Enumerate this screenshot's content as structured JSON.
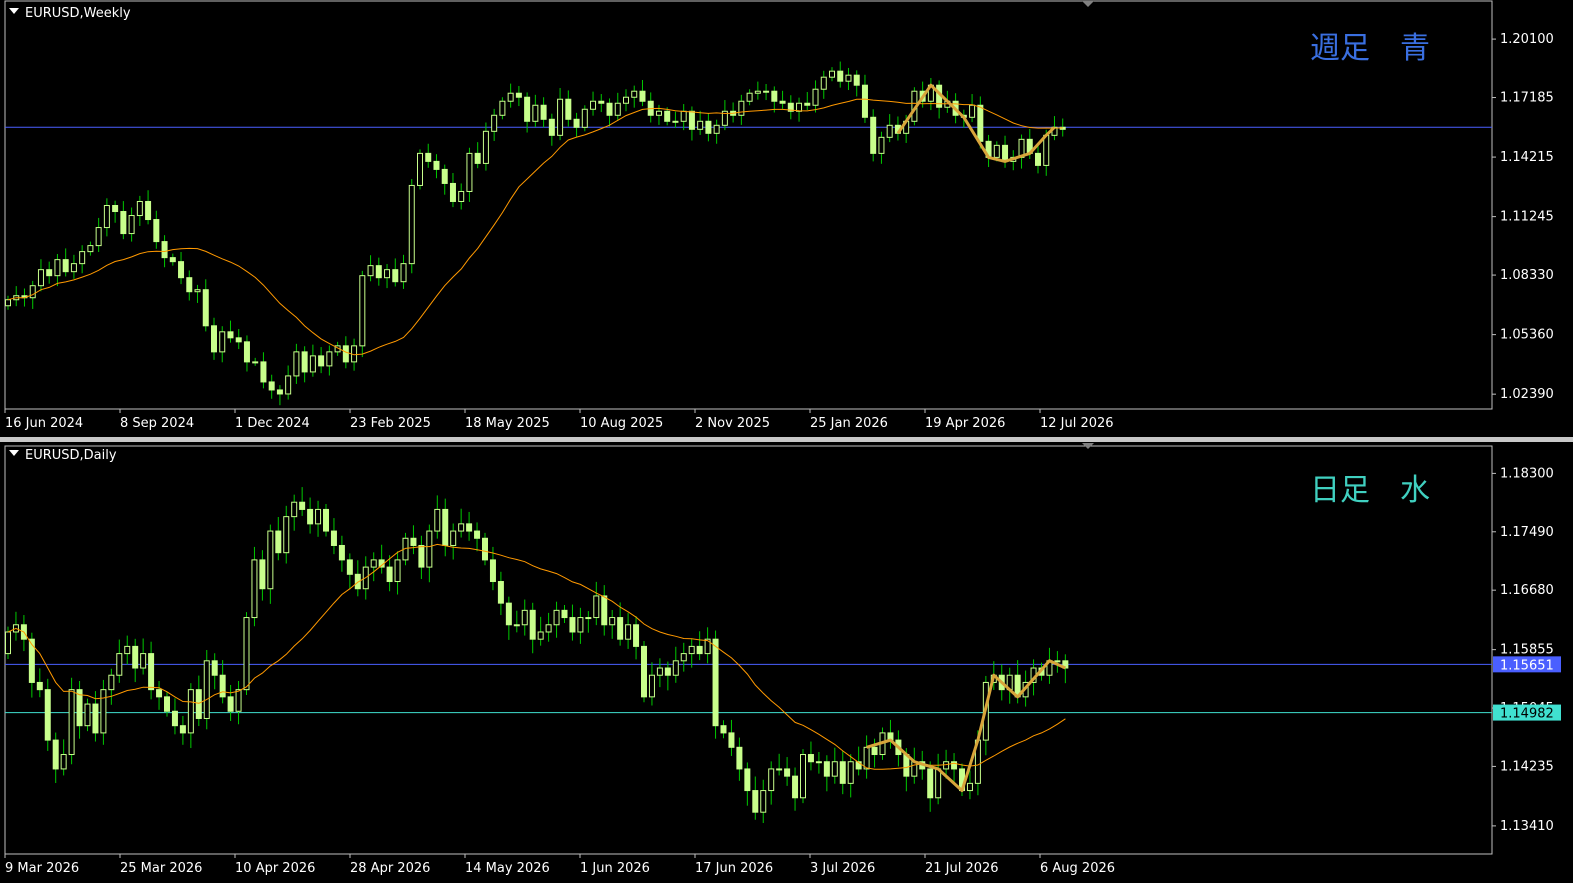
{
  "colors": {
    "background": "#000000",
    "frame": "#c0c0c0",
    "text": "#ffffff",
    "candle": "#c8ff8c",
    "wick": "#00c800",
    "ma": "#ff9900",
    "zigzag": "#d8a53a",
    "weekly_line": "#4a5fff",
    "daily_line_blue": "#4a5fff",
    "daily_line_aqua": "#40e0d0",
    "weekly_label": "#3a6fe0",
    "daily_label": "#40d0c0"
  },
  "weekly": {
    "title": "EURUSD,Weekly",
    "label": "週足　青",
    "x_ticks": [
      "16 Jun 2024",
      "8 Sep 2024",
      "1 Dec 2024",
      "23 Feb 2025",
      "18 May 2025",
      "10 Aug 2025",
      "2 Nov 2025",
      "25 Jan 2026",
      "19 Apr 2026",
      "12 Jul 2026"
    ],
    "y_ticks": [
      "1.20100",
      "1.17185",
      "1.14215",
      "1.11245",
      "1.08330",
      "1.05360",
      "1.02390"
    ],
    "h_line_price": 1.157
  },
  "daily": {
    "title": "EURUSD,Daily",
    "label": "日足　水",
    "x_ticks": [
      "9 Mar 2026",
      "25 Mar 2026",
      "10 Apr 2026",
      "28 Apr 2026",
      "14 May 2026",
      "1 Jun 2026",
      "17 Jun 2026",
      "3 Jul 2026",
      "21 Jul 2026",
      "6 Aug 2026"
    ],
    "y_ticks": [
      "1.18300",
      "1.17490",
      "1.16680",
      "1.15855",
      "1.15045",
      "1.14235",
      "1.13410"
    ],
    "price_tags": [
      "1.15651",
      "1.14982"
    ]
  },
  "chart_data": [
    {
      "type": "candlestick",
      "title": "EURUSD,Weekly",
      "x_tick_labels": [
        "16 Jun 2024",
        "8 Sep 2024",
        "1 Dec 2024",
        "23 Feb 2025",
        "18 May 2025",
        "10 Aug 2025",
        "2 Nov 2025",
        "25 Jan 2026",
        "19 Apr 2026",
        "12 Jul 2026"
      ],
      "y_tick_labels": [
        "1.20100",
        "1.17185",
        "1.14215",
        "1.11245",
        "1.08330",
        "1.05360",
        "1.02390"
      ],
      "ylim": [
        1.0165,
        1.22
      ],
      "close": [
        1.071,
        1.073,
        1.072,
        1.078,
        1.086,
        1.083,
        1.091,
        1.085,
        1.089,
        1.095,
        1.098,
        1.107,
        1.118,
        1.115,
        1.104,
        1.113,
        1.12,
        1.111,
        1.1,
        1.092,
        1.09,
        1.082,
        1.075,
        1.076,
        1.058,
        1.045,
        1.055,
        1.052,
        1.05,
        1.04,
        1.04,
        1.03,
        1.026,
        1.024,
        1.033,
        1.045,
        1.035,
        1.043,
        1.038,
        1.045,
        1.048,
        1.04,
        1.048,
        1.083,
        1.088,
        1.082,
        1.086,
        1.08,
        1.089,
        1.128,
        1.144,
        1.14,
        1.136,
        1.129,
        1.12,
        1.125,
        1.144,
        1.139,
        1.155,
        1.163,
        1.17,
        1.174,
        1.172,
        1.16,
        1.168,
        1.161,
        1.153,
        1.171,
        1.161,
        1.157,
        1.166,
        1.17,
        1.169,
        1.163,
        1.169,
        1.172,
        1.175,
        1.17,
        1.163,
        1.165,
        1.16,
        1.16,
        1.165,
        1.156,
        1.16,
        1.154,
        1.158,
        1.165,
        1.163,
        1.17,
        1.174,
        1.175,
        1.175,
        1.17,
        1.169,
        1.165,
        1.169,
        1.168,
        1.176,
        1.182,
        1.185,
        1.18,
        1.183,
        1.178,
        1.162,
        1.144,
        1.152,
        1.158,
        1.154,
        1.16,
        1.175,
        1.17,
        1.178,
        1.167,
        1.17,
        1.163,
        1.162,
        1.168,
        1.15,
        1.142,
        1.148,
        1.14,
        1.142,
        1.151,
        1.144,
        1.138,
        1.153,
        1.157,
        1.156
      ]
    },
    {
      "type": "candlestick",
      "title": "EURUSD,Daily",
      "x_tick_labels": [
        "9 Mar 2026",
        "25 Mar 2026",
        "10 Apr 2026",
        "28 Apr 2026",
        "14 May 2026",
        "1 Jun 2026",
        "17 Jun 2026",
        "3 Jul 2026",
        "21 Jul 2026",
        "6 Aug 2026"
      ],
      "y_tick_labels": [
        "1.18300",
        "1.17490",
        "1.16680",
        "1.15855",
        "1.15045",
        "1.14235",
        "1.13410"
      ],
      "price_tags": [
        "1.15651",
        "1.14982"
      ],
      "ylim": [
        1.1302,
        1.1868
      ],
      "close": [
        1.161,
        1.162,
        1.16,
        1.154,
        1.153,
        1.146,
        1.142,
        1.144,
        1.153,
        1.148,
        1.151,
        1.147,
        1.153,
        1.155,
        1.158,
        1.159,
        1.156,
        1.158,
        1.153,
        1.152,
        1.15,
        1.148,
        1.147,
        1.153,
        1.149,
        1.157,
        1.155,
        1.152,
        1.15,
        1.153,
        1.163,
        1.171,
        1.167,
        1.175,
        1.172,
        1.177,
        1.179,
        1.178,
        1.176,
        1.178,
        1.175,
        1.173,
        1.171,
        1.169,
        1.167,
        1.17,
        1.171,
        1.17,
        1.168,
        1.171,
        1.174,
        1.173,
        1.17,
        1.175,
        1.178,
        1.173,
        1.175,
        1.176,
        1.175,
        1.174,
        1.171,
        1.168,
        1.165,
        1.162,
        1.162,
        1.164,
        1.16,
        1.161,
        1.162,
        1.164,
        1.163,
        1.161,
        1.163,
        1.163,
        1.166,
        1.162,
        1.163,
        1.16,
        1.162,
        1.159,
        1.152,
        1.155,
        1.156,
        1.155,
        1.157,
        1.158,
        1.159,
        1.158,
        1.16,
        1.148,
        1.147,
        1.145,
        1.142,
        1.139,
        1.136,
        1.139,
        1.142,
        1.142,
        1.141,
        1.138,
        1.144,
        1.143,
        1.143,
        1.141,
        1.143,
        1.14,
        1.143,
        1.142,
        1.145,
        1.144,
        1.147,
        1.146,
        1.144,
        1.141,
        1.143,
        1.142,
        1.138,
        1.142,
        1.143,
        1.142,
        1.139,
        1.14,
        1.146,
        1.154,
        1.155,
        1.153,
        1.155,
        1.152,
        1.154,
        1.156,
        1.155,
        1.157,
        1.157,
        1.156
      ]
    }
  ]
}
